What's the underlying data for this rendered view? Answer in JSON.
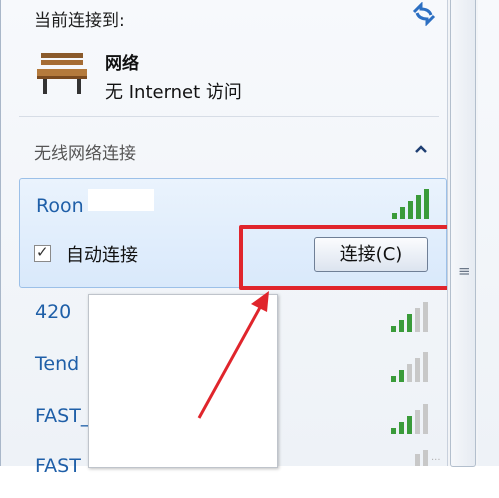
{
  "header": {
    "label": "当前连接到:",
    "refresh_icon": "network-refresh-icon"
  },
  "current_network": {
    "name": "网络",
    "status": "无 Internet 访问",
    "icon": "bench-icon"
  },
  "wireless_section": {
    "title": "无线网络连接",
    "collapse_icon": "chevron-up-icon"
  },
  "selected_network": {
    "ssid": "Roon",
    "auto_connect_label": "自动连接",
    "auto_connect_checked": "✓",
    "connect_button": "连接(C)"
  },
  "networks": [
    {
      "ssid": "420"
    },
    {
      "ssid": "Tend"
    },
    {
      "ssid": "FAST_"
    },
    {
      "ssid": "FAST"
    }
  ],
  "annotation": {
    "highlight_color": "#e0252c"
  },
  "watermark": "..."
}
